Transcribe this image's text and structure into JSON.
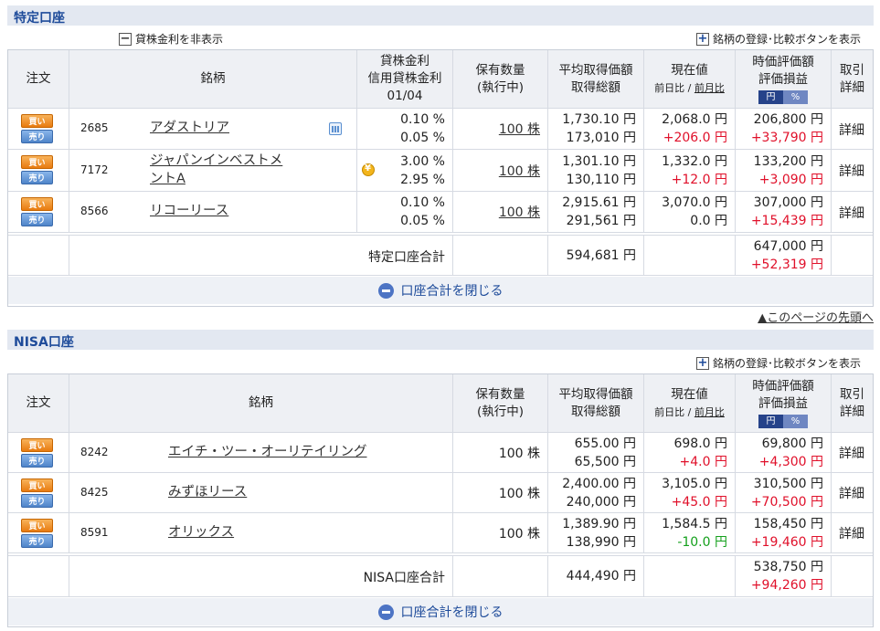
{
  "tokutei": {
    "title": "特定口座",
    "hide_rate_label": "貸株金利を非表示",
    "show_buttons_label": "銘柄の登録･比較ボタンを表示",
    "headers": {
      "order": "注文",
      "issue": "銘柄",
      "lending_rate": "貸株金利",
      "margin_rate": "信用貸株金利",
      "rate_date": "01/04",
      "holding": "保有数量",
      "executing": "(執行中)",
      "avg_price": "平均取得価額",
      "total_cost": "取得総額",
      "current": "現在値",
      "day_change": "前日比",
      "sep": "/",
      "month_change": "前月比",
      "market_value": "時価評価額",
      "gain_loss": "評価損益",
      "yen": "円",
      "pct": "%",
      "trade": "取引",
      "detail": "詳細"
    },
    "rows": [
      {
        "buy": "買い",
        "sell": "売り",
        "code": "2685",
        "name": "アダストリア",
        "icon": "calendar-icon",
        "rate1": "0.10 %",
        "rate2": "0.05 %",
        "qty": "100 株",
        "avg": "1,730.10 円",
        "cost": "173,010 円",
        "price": "2,068.0 円",
        "change": "+206.0 円",
        "value": "206,800 円",
        "pl": "+33,790 円",
        "detail": "詳細"
      },
      {
        "buy": "買い",
        "sell": "売り",
        "code": "7172",
        "name": "ジャパンインベストメ",
        "name2": "ントA",
        "icon": "coin-icon",
        "rate1": "3.00 %",
        "rate2": "2.95 %",
        "qty": "100 株",
        "avg": "1,301.10 円",
        "cost": "130,110 円",
        "price": "1,332.0 円",
        "change": "+12.0 円",
        "value": "133,200 円",
        "pl": "+3,090 円",
        "detail": "詳細"
      },
      {
        "buy": "買い",
        "sell": "売り",
        "code": "8566",
        "name": "リコーリース",
        "rate1": "0.10 %",
        "rate2": "0.05 %",
        "qty": "100 株",
        "avg": "2,915.61 円",
        "cost": "291,561 円",
        "price": "3,070.0 円",
        "change": "0.0 円",
        "value": "307,000 円",
        "pl": "+15,439 円",
        "detail": "詳細"
      }
    ],
    "total_label": "特定口座合計",
    "total_cost": "594,681 円",
    "total_value": "647,000 円",
    "total_pl": "+52,319 円",
    "close_label": "口座合計を閉じる"
  },
  "page_top_link": "▲このページの先頭へ",
  "nisa": {
    "title": "NISA口座",
    "show_buttons_label": "銘柄の登録･比較ボタンを表示",
    "headers": {
      "order": "注文",
      "issue": "銘柄",
      "holding": "保有数量",
      "executing": "(執行中)",
      "avg_price": "平均取得価額",
      "total_cost": "取得総額",
      "current": "現在値",
      "day_change": "前日比",
      "sep": "/",
      "month_change": "前月比",
      "market_value": "時価評価額",
      "gain_loss": "評価損益",
      "yen": "円",
      "pct": "%",
      "trade": "取引",
      "detail": "詳細"
    },
    "rows": [
      {
        "buy": "買い",
        "sell": "売り",
        "code": "8242",
        "name": "エイチ・ツー・オーリテイリング",
        "qty": "100 株",
        "avg": "655.00 円",
        "cost": "65,500 円",
        "price": "698.0 円",
        "change": "+4.0 円",
        "value": "69,800 円",
        "pl": "+4,300 円",
        "detail": "詳細"
      },
      {
        "buy": "買い",
        "sell": "売り",
        "code": "8425",
        "name": "みずほリース",
        "qty": "100 株",
        "avg": "2,400.00 円",
        "cost": "240,000 円",
        "price": "3,105.0 円",
        "change": "+45.0 円",
        "value": "310,500 円",
        "pl": "+70,500 円",
        "detail": "詳細"
      },
      {
        "buy": "買い",
        "sell": "売り",
        "code": "8591",
        "name": "オリックス",
        "qty": "100 株",
        "avg": "1,389.90 円",
        "cost": "138,990 円",
        "price": "1,584.5 円",
        "change": "-10.0 円",
        "value": "158,450 円",
        "pl": "+19,460 円",
        "detail": "詳細"
      }
    ],
    "total_label": "NISA口座合計",
    "total_cost": "444,490 円",
    "total_value": "538,750 円",
    "total_pl": "+94,260 円",
    "close_label": "口座合計を閉じる"
  },
  "colors": {
    "positive": "#e0102a",
    "negative": "#14a01c",
    "accent": "#1e4b9a"
  }
}
